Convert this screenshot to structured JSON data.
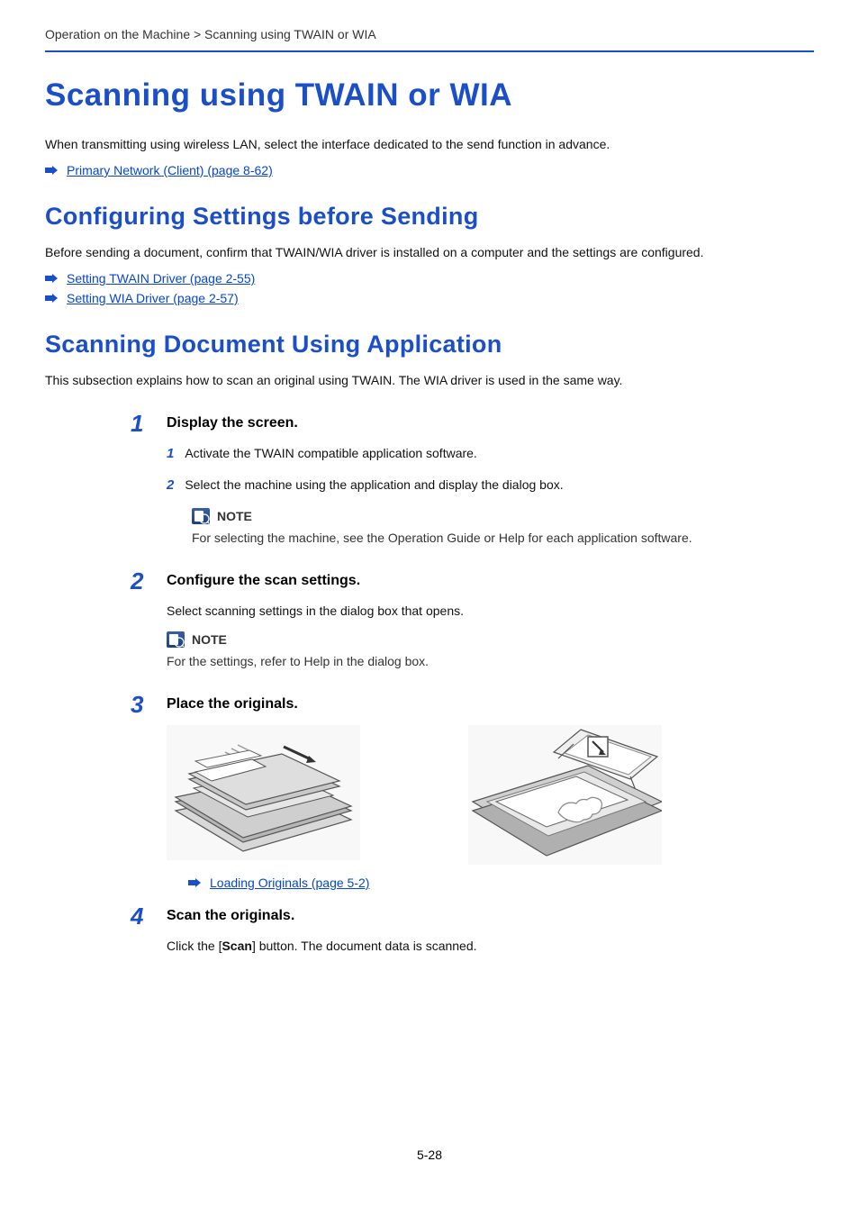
{
  "breadcrumb": "Operation on the Machine > Scanning using TWAIN or WIA",
  "title_main": "Scanning using TWAIN or WIA",
  "intro_text": "When transmitting using wireless LAN, select the interface dedicated to the send function in advance.",
  "link_primary": "Primary Network (Client) (page 8-62)",
  "title_config": "Configuring Settings before Sending",
  "config_text": "Before sending a document, confirm that TWAIN/WIA driver is installed on a computer and the settings are configured.",
  "link_twain": "Setting TWAIN Driver (page 2-55)",
  "link_wia": "Setting WIA Driver (page 2-57)",
  "title_scan": "Scanning Document Using Application",
  "scan_text": "This subsection explains how to scan an original using TWAIN. The WIA driver is used in the same way.",
  "steps": [
    {
      "num": "1",
      "title": "Display the screen.",
      "substeps": [
        {
          "num": "1",
          "text": "Activate the TWAIN compatible application software."
        },
        {
          "num": "2",
          "text": "Select the machine using the application and display the dialog box."
        }
      ],
      "note": {
        "label": "NOTE",
        "text": "For selecting the machine, see the Operation Guide or Help for each application software."
      }
    },
    {
      "num": "2",
      "title": "Configure the scan settings.",
      "body": "Select scanning settings in the dialog box that opens.",
      "note": {
        "label": "NOTE",
        "text": "For the settings, refer to Help in the dialog box."
      }
    },
    {
      "num": "3",
      "title": "Place the originals.",
      "link": "Loading Originals (page 5-2)"
    },
    {
      "num": "4",
      "title": "Scan the originals.",
      "body_parts": [
        "Click the [",
        "Scan",
        "] button. The document data is scanned."
      ]
    }
  ],
  "page_number": "5-28"
}
